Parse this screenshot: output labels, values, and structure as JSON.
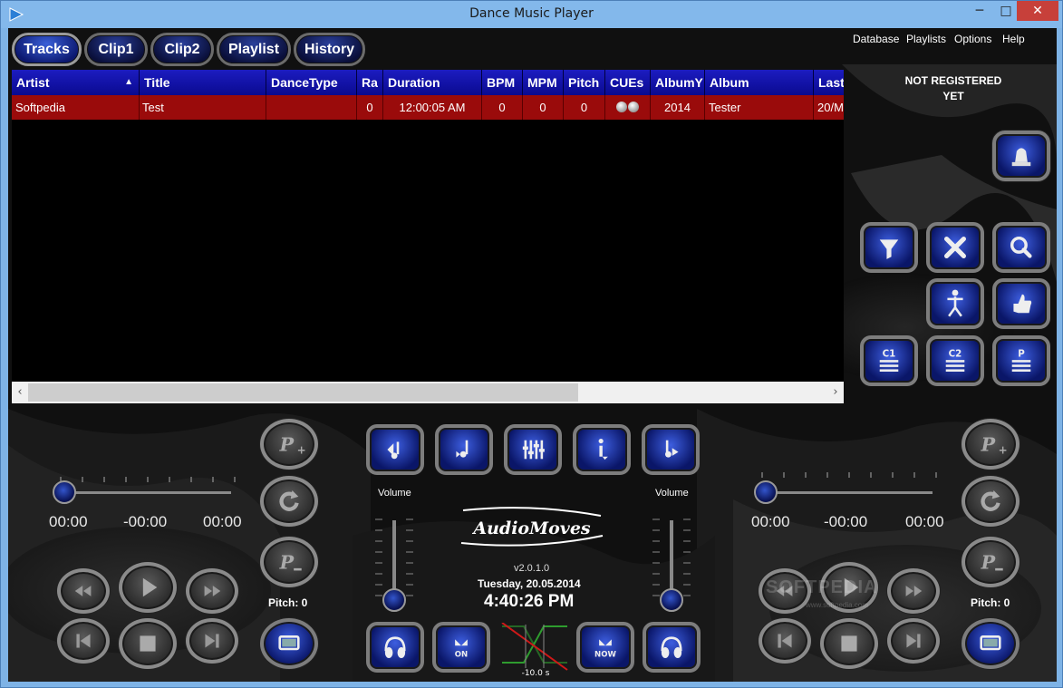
{
  "window": {
    "title": "Dance Music Player",
    "minimize": "─",
    "maximize": "□",
    "close": "✕"
  },
  "tabs": [
    {
      "label": "Tracks",
      "active": true
    },
    {
      "label": "Clip1"
    },
    {
      "label": "Clip2"
    },
    {
      "label": "Playlist"
    },
    {
      "label": "History"
    }
  ],
  "menu": [
    "Database",
    "Playlists",
    "Options",
    "Help"
  ],
  "registration": {
    "line1": "NOT REGISTERED",
    "line2": "YET"
  },
  "grid": {
    "columns": [
      "Artist",
      "Title",
      "DanceType",
      "Ra",
      "Duration",
      "BPM",
      "MPM",
      "Pitch",
      "CUEs",
      "AlbumY",
      "Album",
      "Last"
    ],
    "sorted_column": "Artist",
    "rows": [
      {
        "artist": "Softpedia",
        "title": "Test",
        "dancetype": "",
        "rating": "0",
        "duration": "12:00:05 AM",
        "bpm": "0",
        "mpm": "0",
        "pitch": "0",
        "cues": "",
        "albumyear": "2014",
        "album": "Tester",
        "last": "20/M"
      }
    ]
  },
  "scrollbar": {
    "left": "‹",
    "right": "›"
  },
  "left_deck": {
    "elapsed": "00:00",
    "remaining": "-00:00",
    "total": "00:00",
    "pitch_label": "Pitch: 0",
    "position": 0
  },
  "right_deck": {
    "elapsed": "00:00",
    "remaining": "-00:00",
    "total": "00:00",
    "pitch_label": "Pitch: 0",
    "position": 0
  },
  "mixer": {
    "volume_left_label": "Volume",
    "volume_right_label": "Volume",
    "logo": "AudioMoves",
    "version": "v2.0.1.0",
    "date": "Tuesday, 20.05.2014",
    "clock": "4:40:26 PM",
    "crossfade_time": "-10.0 s",
    "on_label": "ON",
    "now_label": "NOW"
  },
  "watermark": {
    "name": "SOFTPEDIA",
    "url": "www.softpedia.com"
  },
  "colors": {
    "header": "#0f0fa8",
    "selected_row": "#9a0b0b",
    "button": "#1a2fa8",
    "close": "#c7403a"
  }
}
